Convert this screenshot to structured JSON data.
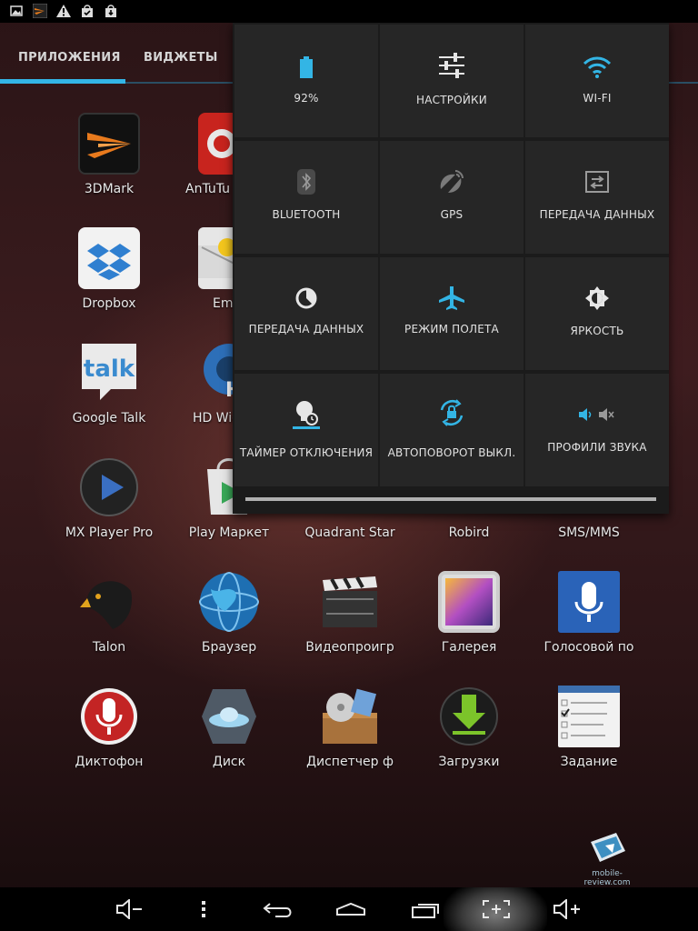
{
  "status_bar": {
    "icons": [
      "image-icon",
      "3dmark-notification-icon",
      "warning-icon",
      "bag-check-icon",
      "bag-download-icon"
    ]
  },
  "drawer": {
    "tabs": [
      {
        "label": "ПРИЛОЖЕНИЯ",
        "active": true
      },
      {
        "label": "ВИДЖЕТЫ",
        "active": false
      }
    ],
    "apps": [
      {
        "label": "3DMark",
        "icon": "3dmark-icon"
      },
      {
        "label": "AnTuTu",
        "icon": "antutu-icon"
      },
      {
        "label": "Dropbox",
        "icon": "dropbox-icon"
      },
      {
        "label": "Em",
        "icon": "email-icon"
      },
      {
        "label": "Google Talk",
        "icon": "google-talk-icon"
      },
      {
        "label": "HD Wid",
        "icon": "hd-widgets-icon"
      },
      {
        "label": "MX Player Pro",
        "icon": "mx-player-icon"
      },
      {
        "label": "Play Маркет",
        "icon": "play-market-icon"
      },
      {
        "label": "Quadrant Star",
        "icon": "quadrant-icon"
      },
      {
        "label": "Robird",
        "icon": "robird-icon"
      },
      {
        "label": "SMS/MMS",
        "icon": "sms-icon"
      },
      {
        "label": "Talon",
        "icon": "talon-icon"
      },
      {
        "label": "Браузер",
        "icon": "browser-icon"
      },
      {
        "label": "Видеопроигр",
        "icon": "video-player-icon"
      },
      {
        "label": "Галерея",
        "icon": "gallery-icon"
      },
      {
        "label": "Голосовой по",
        "icon": "voice-search-icon"
      },
      {
        "label": "Диктофон",
        "icon": "dictaphone-icon"
      },
      {
        "label": "Диск",
        "icon": "disk-icon"
      },
      {
        "label": "Диспетчер ф",
        "icon": "file-manager-icon"
      },
      {
        "label": "Загрузки",
        "icon": "downloads-icon"
      },
      {
        "label": "Задание",
        "icon": "tasks-icon"
      }
    ]
  },
  "quick_settings": {
    "tiles": [
      {
        "label": "92%",
        "icon": "battery-icon",
        "color": "#33b5e5"
      },
      {
        "label": "НАСТРОЙКИ",
        "icon": "settings-sliders-icon",
        "color": "#e6e6e6"
      },
      {
        "label": "WI-FI",
        "icon": "wifi-icon",
        "color": "#33b5e5"
      },
      {
        "label": "BLUETOOTH",
        "icon": "bluetooth-icon",
        "color": "#8a8a8a"
      },
      {
        "label": "GPS",
        "icon": "gps-icon",
        "color": "#8a8a8a"
      },
      {
        "label": "ПЕРЕДАЧА ДАННЫХ",
        "icon": "data-transfer-icon",
        "color": "#8a8a8a"
      },
      {
        "label": "ПЕРЕДАЧА ДАННЫХ",
        "icon": "data-usage-icon",
        "color": "#e6e6e6"
      },
      {
        "label": "РЕЖИМ ПОЛЕТА",
        "icon": "airplane-icon",
        "color": "#33b5e5"
      },
      {
        "label": "ЯРКОСТЬ",
        "icon": "brightness-icon",
        "color": "#e6e6e6"
      },
      {
        "label": "ТАЙМЕР ОТКЛЮЧЕНИЯ",
        "icon": "sleep-timer-icon",
        "color": "#e6e6e6"
      },
      {
        "label": "АВТОПОВОРОТ ВЫКЛ.",
        "icon": "auto-rotate-icon",
        "color": "#33b5e5"
      },
      {
        "label": "ПРОФИЛИ ЗВУКА",
        "icon": "sound-profile-icon",
        "color": "#33b5e5"
      }
    ]
  },
  "nav_bar": {
    "buttons": [
      "volume-down-icon",
      "menu-icon",
      "back-icon",
      "home-icon",
      "recent-apps-icon",
      "screenshot-icon",
      "volume-up-icon"
    ]
  },
  "watermark": {
    "text": "mobile-review.com"
  },
  "colors": {
    "accent": "#33b5e5",
    "panel": "#262626"
  }
}
